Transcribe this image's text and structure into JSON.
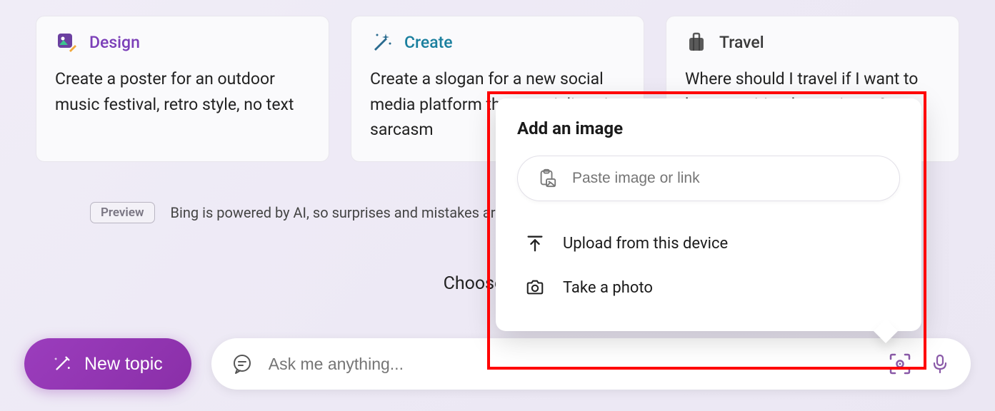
{
  "cards": [
    {
      "title": "Design",
      "body": "Create a poster for an outdoor music festival, retro style, no text"
    },
    {
      "title": "Create",
      "body": "Create a slogan for a new social media platform that specializes in sarcasm"
    },
    {
      "title": "Travel",
      "body": "Where should I travel if I want to have a spiritual experience?"
    }
  ],
  "preview": {
    "badge": "Preview",
    "text": "Bing is powered by AI, so surprises and mistakes are c"
  },
  "choose_text": "Choose a con",
  "new_topic": "New topic",
  "ask_placeholder": "Ask me anything...",
  "popup": {
    "title": "Add an image",
    "paste_placeholder": "Paste image or link",
    "upload": "Upload from this device",
    "take_photo": "Take a photo"
  }
}
